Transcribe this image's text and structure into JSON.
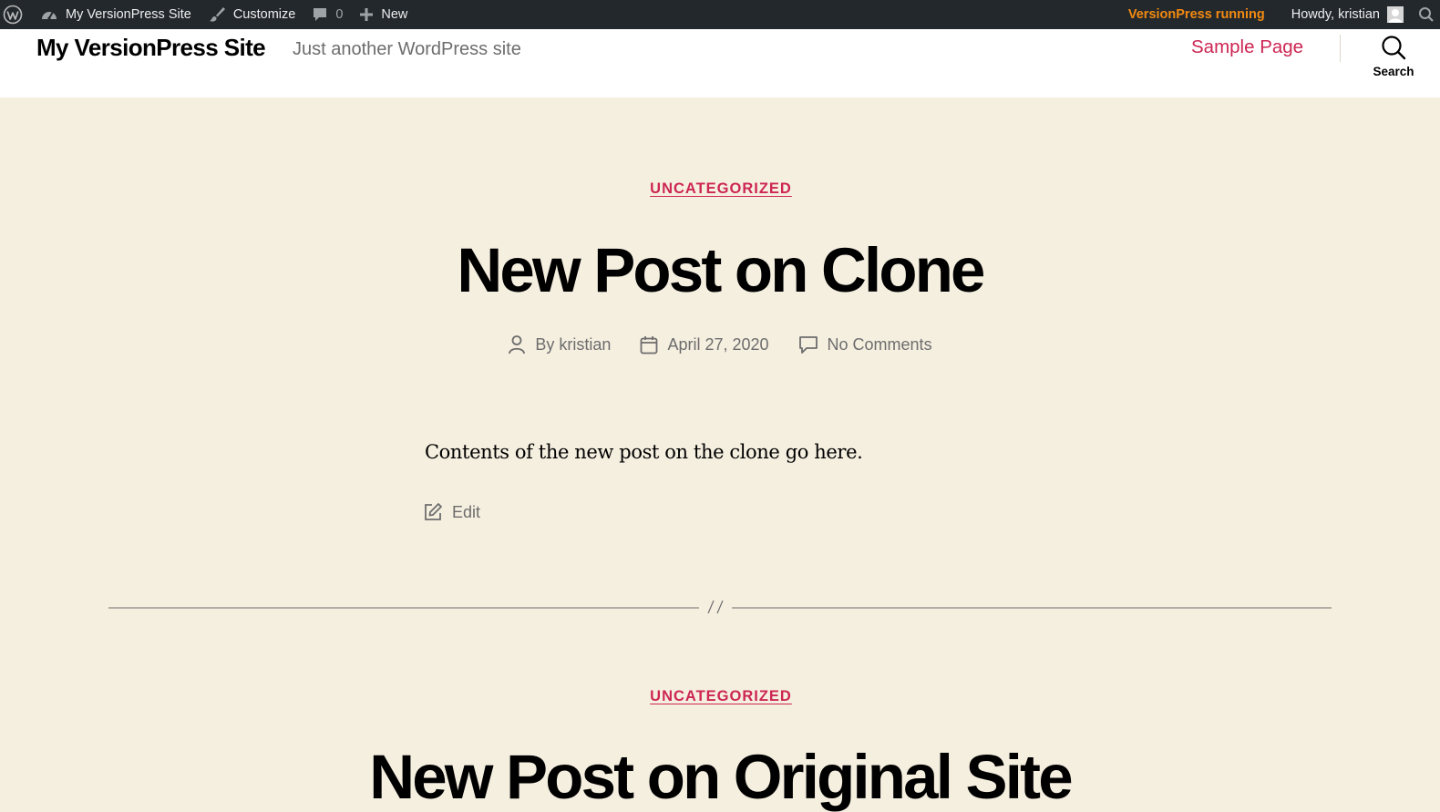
{
  "admin_bar": {
    "site_name": "My VersionPress Site",
    "customize": "Customize",
    "comments_count": "0",
    "new": "New",
    "versionpress_status": "VersionPress running",
    "greeting": "Howdy, kristian",
    "icons": [
      "wordpress-logo-icon",
      "dashboard-icon",
      "brush-icon",
      "comment-bubble-icon",
      "plus-icon",
      "avatar",
      "search-icon"
    ],
    "versionpress_color": "#f28a11"
  },
  "header": {
    "site_title": "My VersionPress Site",
    "tagline": "Just another WordPress site",
    "nav": [
      {
        "label": "Sample Page"
      }
    ],
    "search_label": "Search",
    "accent_color": "#cd2653"
  },
  "posts": [
    {
      "category": "UNCATEGORIZED",
      "title": "New Post on Clone",
      "author": "By kristian",
      "date": "April 27, 2020",
      "comments": "No Comments",
      "content": "Contents of the new post on the clone go here.",
      "edit_label": "Edit"
    },
    {
      "category": "UNCATEGORIZED",
      "title": "New Post on Original Site"
    }
  ],
  "separator": "//",
  "background_color": "#f5efe0"
}
